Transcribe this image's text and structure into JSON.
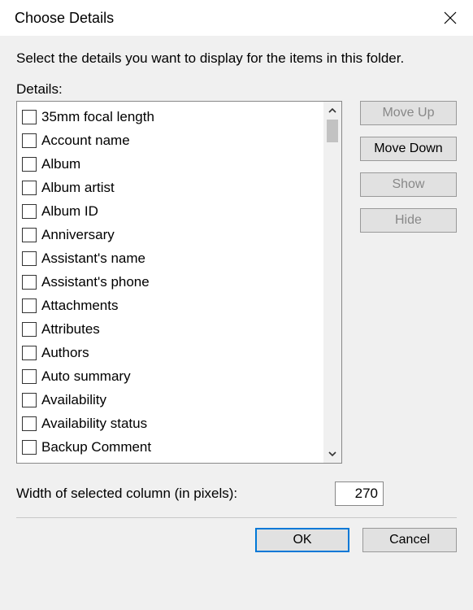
{
  "title": "Choose Details",
  "instruction": "Select the details you want to display for the items in this folder.",
  "details_label": "Details:",
  "items": [
    "35mm focal length",
    "Account name",
    "Album",
    "Album artist",
    "Album ID",
    "Anniversary",
    "Assistant's name",
    "Assistant's phone",
    "Attachments",
    "Attributes",
    "Authors",
    "Auto summary",
    "Availability",
    "Availability status",
    "Backup Comment"
  ],
  "side_buttons": {
    "move_up": "Move Up",
    "move_down": "Move Down",
    "show": "Show",
    "hide": "Hide"
  },
  "width_label": "Width of selected column (in pixels):",
  "width_value": "270",
  "ok": "OK",
  "cancel": "Cancel"
}
